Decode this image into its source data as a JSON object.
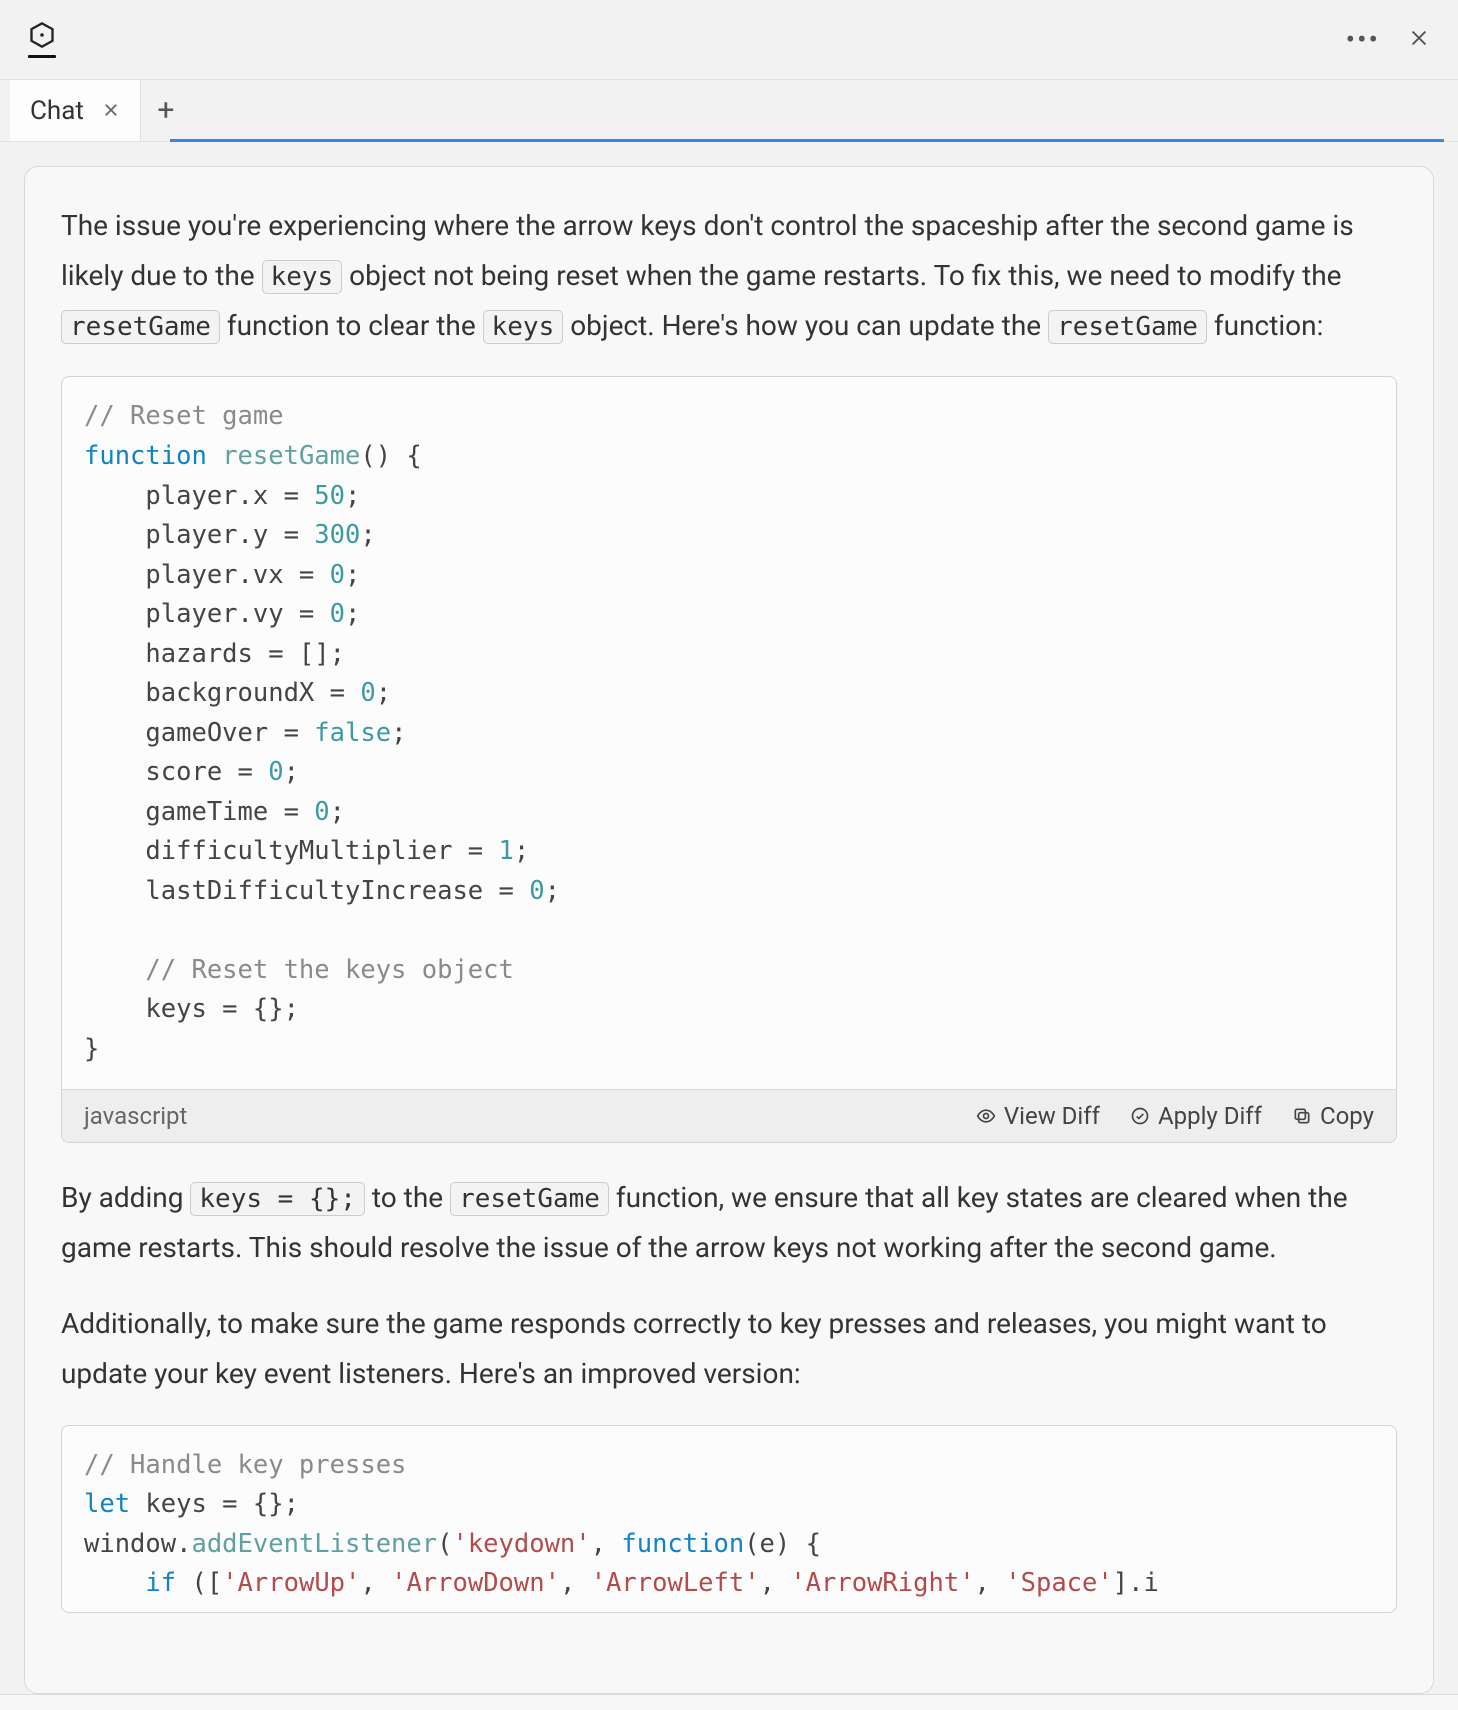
{
  "tabs": {
    "active_label": "Chat"
  },
  "explanation": {
    "p1_part1": "The issue you're experiencing where the arrow keys don't control the spaceship after the second game is likely due to the ",
    "p1_code1": "keys",
    "p1_part2": " object not being reset when the game restarts. To fix this, we need to modify the ",
    "p1_code2": "resetGame",
    "p1_part3": " function to clear the ",
    "p1_code3": "keys",
    "p1_part4": " object. Here's how you can update the ",
    "p1_code4": "resetGame",
    "p1_part5": " function:"
  },
  "code1": {
    "language": "javascript",
    "actions": {
      "view_diff": "View Diff",
      "apply_diff": "Apply Diff",
      "copy": "Copy"
    },
    "lines": {
      "c_reset": "// Reset game",
      "kw_function": "function",
      "fn_name": "resetGame",
      "open": "() {",
      "l_px_a": "    player.x = ",
      "l_px_b": "50",
      "semi": ";",
      "l_py_a": "    player.y = ",
      "l_py_b": "300",
      "l_vx_a": "    player.vx = ",
      "l_vx_b": "0",
      "l_vy_a": "    player.vy = ",
      "l_vy_b": "0",
      "l_haz": "    hazards = [];",
      "l_bgx_a": "    backgroundX = ",
      "l_bgx_b": "0",
      "l_go_a": "    gameOver = ",
      "l_go_b": "false",
      "l_sc_a": "    score = ",
      "l_sc_b": "0",
      "l_gt_a": "    gameTime = ",
      "l_gt_b": "0",
      "l_dm_a": "    difficultyMultiplier = ",
      "l_dm_b": "1",
      "l_ld_a": "    lastDifficultyIncrease = ",
      "l_ld_b": "0",
      "c_keys": "    // Reset the keys object",
      "l_keys": "    keys = {};",
      "close": "}"
    }
  },
  "explanation2": {
    "p2_part1": "By adding ",
    "p2_code1": "keys = {};",
    "p2_part2": " to the ",
    "p2_code2": "resetGame",
    "p2_part3": " function, we ensure that all key states are cleared when the game restarts. This should resolve the issue of the arrow keys not working after the second game.",
    "p3": "Additionally, to make sure the game responds correctly to key presses and releases, you might want to update your key event listeners. Here's an improved version:"
  },
  "code2": {
    "c_handle": "// Handle key presses",
    "kw_let": "let",
    "l_keys": " keys = {};",
    "l_win": "window.",
    "fn_add": "addEventListener",
    "l_args_open": "(",
    "str_keydown": "'keydown'",
    "l_comma": ", ",
    "kw_function": "function",
    "l_eopen": "(e) {",
    "kw_if": "if",
    "l_arr_open": " ([",
    "str_up": "'ArrowUp'",
    "str_down": "'ArrowDown'",
    "str_left": "'ArrowLeft'",
    "str_right": "'ArrowRight'",
    "str_space": "'Space'",
    "l_tail": "].i"
  }
}
